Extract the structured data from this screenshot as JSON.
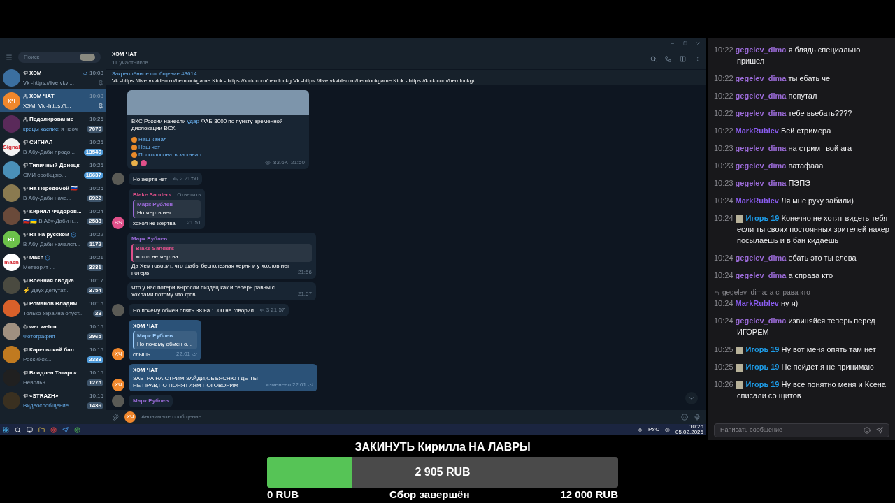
{
  "sidebar": {
    "search_placeholder": "Поиск",
    "chats": [
      {
        "kind": "channel",
        "name": "ХЭМ",
        "time": "10:08",
        "preview": "Vk -https://live.vkvi...",
        "color": "#3b6fa0",
        "pinned": true,
        "read": true,
        "selected": false
      },
      {
        "kind": "group",
        "name": "ХЭМ ЧАТ",
        "time": "10:08",
        "sender": "ХЭМ:",
        "preview": "Vk -https://l...",
        "color": "#f0872c",
        "avatar_text": "ХЧ",
        "pinned": true,
        "selected": true
      },
      {
        "kind": "group",
        "name": "Педолирование",
        "time": "10:26",
        "sender": "крецы каспис:",
        "preview": "я неоч",
        "color": "#5a2a5a",
        "badge": "7076",
        "muted": true,
        "selected": false
      },
      {
        "kind": "channel",
        "name": "СИГНАЛ",
        "time": "10:25",
        "preview": "В Абу-Даби продо...",
        "color": "#f2f2f2",
        "avatar_text": "Signal",
        "badge": "13546",
        "muted": false,
        "selected": false
      },
      {
        "kind": "channel",
        "name": "Типичный Донецк",
        "time": "10:25",
        "preview": "СМИ сообщаю...",
        "color": "#4a90b8",
        "badge": "16637",
        "muted": false,
        "selected": false
      },
      {
        "kind": "channel",
        "name": "На ПередоVой 🇷🇺",
        "time": "10:25",
        "preview": "В Абу-Даби нача...",
        "color": "#8a7a50",
        "badge": "6922",
        "muted": true,
        "selected": false
      },
      {
        "kind": "channel",
        "name": "Кирилл Фёдоров...",
        "time": "10:24",
        "preview": "🇷🇺🇺🇦 В Абу-Даби н...",
        "color": "#6a4a3a",
        "badge": "2588",
        "muted": true,
        "selected": false
      },
      {
        "kind": "channel",
        "name": "RT на русском",
        "verified": true,
        "time": "10:22",
        "preview": "В Абу-Даби начался...",
        "color": "#6cc24a",
        "avatar_text": "RT",
        "badge": "1172",
        "muted": true,
        "selected": false
      },
      {
        "kind": "channel",
        "name": "Mash",
        "verified": true,
        "time": "10:21",
        "preview": "Метеорит ...",
        "color": "#ffffff",
        "avatar_text": "mash",
        "badge": "3331",
        "muted": true,
        "selected": false
      },
      {
        "kind": "channel",
        "name": "Военная сводка",
        "time": "10:17",
        "preview": "⚡ Двух депутат...",
        "color": "#4a4a40",
        "badge": "3754",
        "muted": true,
        "selected": false
      },
      {
        "kind": "channel",
        "name": "Романов Владим...",
        "time": "10:15",
        "preview": "Только Украина опуст...",
        "color": "#d8602a",
        "badge": "28",
        "muted": true,
        "selected": false
      },
      {
        "kind": "app",
        "name": "war webm.",
        "time": "10:15",
        "preview": "Фотография",
        "highlight": true,
        "color": "#a09080",
        "badge": "2965",
        "muted": true,
        "selected": false
      },
      {
        "kind": "channel",
        "name": "Карельский бал...",
        "time": "10:15",
        "preview": "Российск...",
        "color": "#c07a20",
        "badge": "2333",
        "muted": false,
        "selected": false
      },
      {
        "kind": "channel",
        "name": "Владлен Татарск...",
        "time": "10:15",
        "preview": "Невольн...",
        "color": "#202020",
        "badge": "1275",
        "muted": true,
        "selected": false
      },
      {
        "kind": "channel",
        "name": "«STRAZH»",
        "time": "10:15",
        "preview": "Видеосообщение",
        "highlight": true,
        "color": "#3a3020",
        "badge": "1436",
        "muted": true,
        "selected": false
      }
    ]
  },
  "chat": {
    "title": "ХЭМ ЧАТ",
    "subtitle": "11 участников",
    "pinned": {
      "title": "Закреплённое сообщение #3614",
      "text": "Vk -https://live.vkvideo.ru/hemlockgame Kick - https://kick.com/hemlockg Vk -https://live.vkvideo.ru/hemlockgame Kick - https://kick.com/hemlockg\\"
    },
    "messages": [
      {
        "kind": "post",
        "text_before": "ВКС России нанесли",
        "link": "удар",
        "text_after": "ФАБ-3000 по пункту временной дислокации ВСУ.",
        "links": [
          "Наш канал",
          "Наш чат",
          "Проголосовать за канал"
        ],
        "views": "83.6K",
        "time": "21:50",
        "outgoing": false
      },
      {
        "kind": "text",
        "text": "Но жертв нет",
        "replies": "2",
        "time": "21:50",
        "avatar": {
          "kind": "photo"
        },
        "outgoing": false
      },
      {
        "kind": "text",
        "author": "Blake Sanders",
        "color": "#e0508a",
        "action": "Ответить",
        "quote": {
          "author": "Марк Рублев",
          "text": "Но жертв нет",
          "color": "#9b6bd8"
        },
        "text": "хохол не жертва",
        "time": "21:51",
        "avatar": {
          "kind": "initials",
          "text": "BS",
          "color": "#e0508a"
        },
        "outgoing": false
      },
      {
        "kind": "text",
        "author": "Марк Рублев",
        "color": "#9b6bd8",
        "quote": {
          "author": "Blake Sanders",
          "text": "хохол не жертва",
          "color": "#e0508a"
        },
        "text": "Да Хем говорит, что фабы бесполезная херня и у хохлов нет потерь.",
        "time": "21:56",
        "outgoing": false
      },
      {
        "kind": "text",
        "text": "Что у нас потери выросли пиздец как и теперь равны с хохлами потому что фпв.",
        "time": "21:57",
        "outgoing": false
      },
      {
        "kind": "text",
        "text": "Но почему обмен опять 38 на 1000 не говорил",
        "replies": "3",
        "time": "21:57",
        "avatar": {
          "kind": "photo"
        },
        "outgoing": false
      },
      {
        "kind": "text",
        "author": "ХЭМ ЧАТ",
        "color": "#ffffff",
        "quote": {
          "author": "Марк Рублев",
          "text": "Но почему обмен о...",
          "color": "#9fd0ff"
        },
        "text": "слышь",
        "time": "22:01",
        "read": true,
        "avatar": {
          "kind": "initials",
          "text": "ХЧ",
          "color": "#f0872c"
        },
        "outgoing": true
      },
      {
        "kind": "text",
        "author": "ХЭМ ЧАТ",
        "color": "#ffffff",
        "text": "ЗАВТРА НА СТРИМ ЗАЙДИ,ОБЪЯСНЮ ГДЕ ТЫ НЕ ПРАВ,ПО ПОНЯТИЯМ ПОГОВОРИМ",
        "edited": "изменено",
        "time": "22:01",
        "read": true,
        "avatar": {
          "kind": "initials",
          "text": "ХЧ",
          "color": "#f0872c"
        },
        "outgoing": true
      },
      {
        "kind": "text",
        "author": "Марк Рублев",
        "color": "#9b6bd8",
        "avatar": {
          "kind": "photo"
        },
        "outgoing": false
      }
    ],
    "input_avatar": "ХЧ",
    "input_placeholder": "Анонимное сообщение..."
  },
  "taskbar": {
    "language": "РУС",
    "time": "10:26",
    "date": "05.02.2026"
  },
  "stream_chat": {
    "messages": [
      {
        "time": "10:22",
        "user": "gegelev_dima",
        "color": "#9b6bd8",
        "text": "я блядь специально пришел"
      },
      {
        "time": "10:22",
        "user": "gegelev_dima",
        "color": "#9b6bd8",
        "text": "ты ебать че"
      },
      {
        "time": "10:22",
        "user": "gegelev_dima",
        "color": "#9b6bd8",
        "text": "попутал"
      },
      {
        "time": "10:22",
        "user": "gegelev_dima",
        "color": "#9b6bd8",
        "text": "тебе вьебать????"
      },
      {
        "time": "10:22",
        "user": "MarkRublev",
        "color": "#8a5cf0",
        "text": "Бей стримера"
      },
      {
        "time": "10:23",
        "user": "gegelev_dima",
        "color": "#9b6bd8",
        "text": "на стрим твой ага"
      },
      {
        "time": "10:23",
        "user": "gegelev_dima",
        "color": "#9b6bd8",
        "text": "ватафааа"
      },
      {
        "time": "10:23",
        "user": "gegelev_dima",
        "color": "#9b6bd8",
        "text": "ПЭПЭ"
      },
      {
        "time": "10:24",
        "user": "MarkRublev",
        "color": "#8a5cf0",
        "text": "Ля мне руку забили)"
      },
      {
        "time": "10:24",
        "user": "Игорь 19",
        "color": "#1e9be6",
        "badge": true,
        "text": "Конечно не хотят видеть тебя если ты своих постоянных зрителей нахер посылаешь и в бан кидаешь"
      },
      {
        "time": "10:24",
        "user": "gegelev_dima",
        "color": "#9b6bd8",
        "text": "ебать это ты слева"
      },
      {
        "time": "10:24",
        "user": "gegelev_dima",
        "color": "#9b6bd8",
        "text": "а справа кто"
      },
      {
        "time": "10:24",
        "user": "MarkRublev",
        "color": "#8a5cf0",
        "reply_to": "gegelev_dima: а справа кто",
        "text": "ну я)"
      },
      {
        "time": "10:24",
        "user": "gegelev_dima",
        "color": "#9b6bd8",
        "text": "извиняйся теперь перед ИГОРЕМ"
      },
      {
        "time": "10:25",
        "user": "Игорь 19",
        "color": "#1e9be6",
        "badge": true,
        "text": "Ну вот меня опять там нет"
      },
      {
        "time": "10:25",
        "user": "Игорь 19",
        "color": "#1e9be6",
        "badge": true,
        "text": "Не пойдет я не принимаю"
      },
      {
        "time": "10:26",
        "user": "Игорь 19",
        "color": "#1e9be6",
        "badge": true,
        "text": "Ну все понятно меня и Ксена списали со щитов"
      }
    ],
    "input_placeholder": "Написать сообщение"
  },
  "goal": {
    "title": "ЗАКИНУТЬ Кирилла НА ЛАВРЫ",
    "amount": "2 905 RUB",
    "level": 0.242,
    "min": "0 RUB",
    "status": "Сбор завершён",
    "max": "12 000 RUB"
  }
}
